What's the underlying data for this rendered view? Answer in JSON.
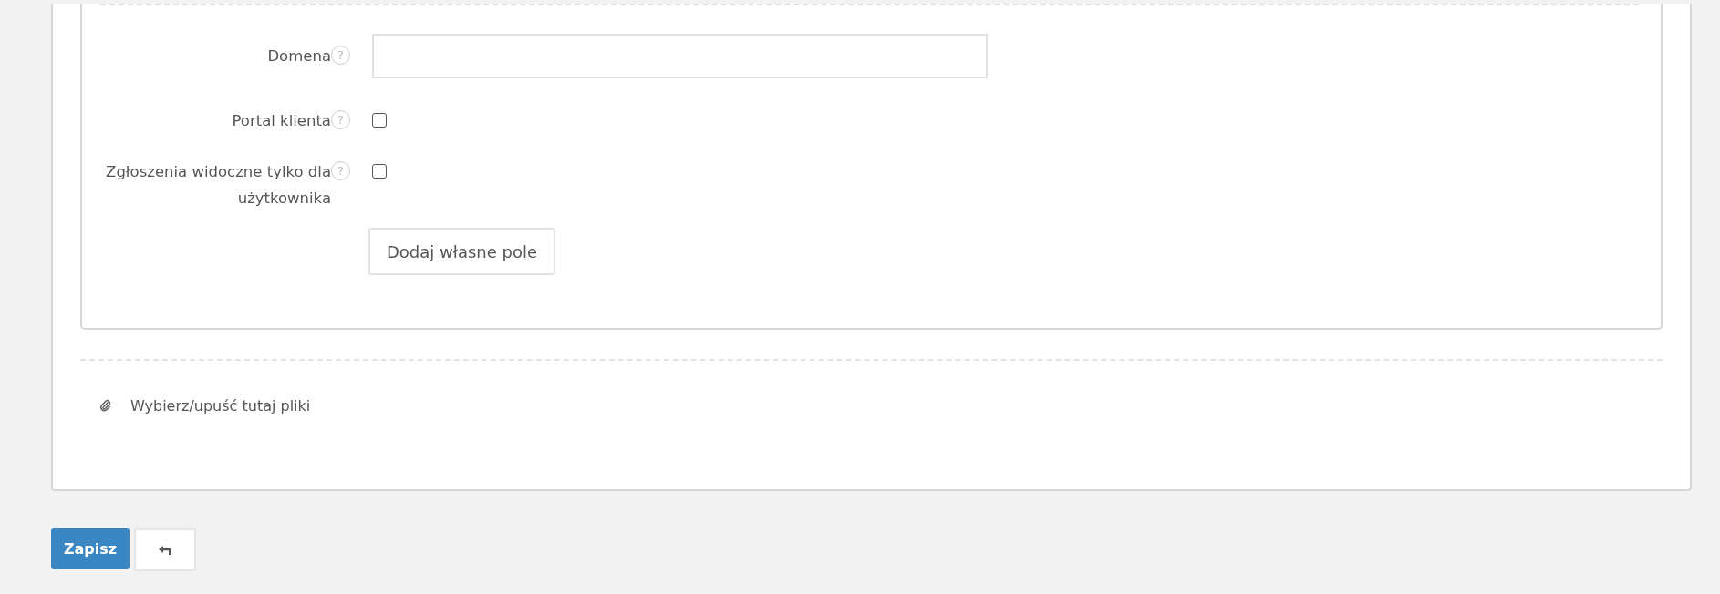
{
  "fields": [
    {
      "kind": "text",
      "label": "Domena"
    },
    {
      "kind": "checkbox",
      "label": "Portal klienta",
      "checked": false
    },
    {
      "kind": "checkbox",
      "label": "Zgłoszenia widoczne tylko dla użytkownika",
      "checked": false
    }
  ],
  "help_mark": "?",
  "add_field_button": "Dodaj własne pole",
  "attachments": {
    "label": "Wybierz/upuść tutaj pliki"
  },
  "save_button": "Zapisz"
}
